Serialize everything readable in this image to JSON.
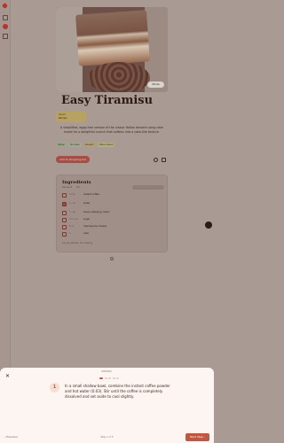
{
  "recipe": {
    "title": "Easy Tiramisu",
    "photo_button": "Photo",
    "saved_label": "Saved",
    "saved_by": "Recipe",
    "description": "A simplified, eggs-free version of the classic Italian dessert using cake made for a delightful crunch that softens into a cake-like texture.",
    "tags": [
      "Italian",
      "No bake",
      "Dessert",
      "Make ahead"
    ],
    "shop_button": "Add to shopping list"
  },
  "ingredients": {
    "heading": "Ingredients",
    "servings": "Serves 8",
    "unit_toggle": "US",
    "rows": [
      {
        "qty": "2 tsp",
        "name": "instant coffee",
        "checked": false
      },
      {
        "qty": "1 cup",
        "name": "water",
        "checked": true
      },
      {
        "qty": "1 cup",
        "name": "heavy whipping cream",
        "checked": false
      },
      {
        "qty": "1/2 cup",
        "name": "sugar",
        "checked": false
      },
      {
        "qty": "8 oz",
        "name": "mascarpone cheese",
        "checked": false
      },
      {
        "qty": "1",
        "name": "cake",
        "checked": false
      }
    ],
    "note": "Cocoa powder, for dusting"
  },
  "step_sheet": {
    "close_icon": "✕",
    "step_number": "1",
    "total_dots": 5,
    "active_dot": 0,
    "text": "In a small shallow bowl, combine the instant coffee powder and hot water (0.03). Stir until the coffee is completely dissolved and set aside to cool slightly.",
    "prev_label": "‹ Previous",
    "counter": "Step 1 of 5",
    "next_label": "Next Step ›"
  },
  "colors": {
    "accent": "#c2563f",
    "sheet_bg": "#fdf5f1"
  }
}
